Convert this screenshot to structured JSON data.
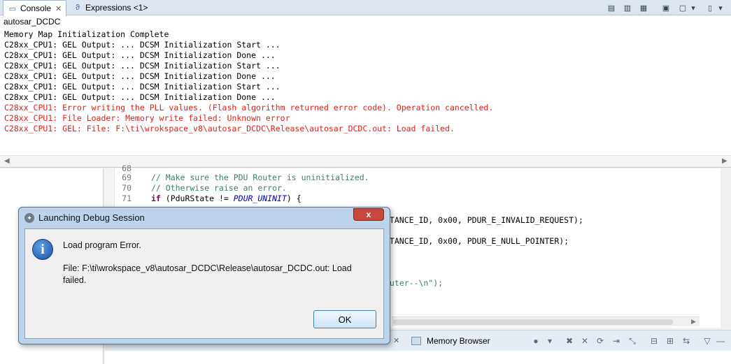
{
  "console": {
    "tabs": [
      {
        "label": "Console",
        "icon": "console-icon"
      },
      {
        "label": "Expressions <1>",
        "icon": "expressions-icon"
      }
    ],
    "name": "autosar_DCDC",
    "lines": [
      {
        "text": "Memory Map Initialization Complete",
        "type": "normal"
      },
      {
        "text": "C28xx_CPU1: GEL Output: ... DCSM Initialization Start ...",
        "type": "normal"
      },
      {
        "text": "C28xx_CPU1: GEL Output: ... DCSM Initialization Done ...",
        "type": "normal"
      },
      {
        "text": "C28xx_CPU1: GEL Output: ... DCSM Initialization Start ...",
        "type": "normal"
      },
      {
        "text": "C28xx_CPU1: GEL Output: ... DCSM Initialization Done ...",
        "type": "normal"
      },
      {
        "text": "C28xx_CPU1: GEL Output: ... DCSM Initialization Start ...",
        "type": "normal"
      },
      {
        "text": "C28xx_CPU1: GEL Output: ... DCSM Initialization Done ...",
        "type": "normal"
      },
      {
        "text": "C28xx_CPU1: Error writing the PLL values. (Flash algorithm returned error code). Operation cancelled.",
        "type": "error"
      },
      {
        "text": "C28xx_CPU1: File Loader: Memory write failed: Unknown error",
        "type": "error"
      },
      {
        "text": "C28xx_CPU1: GEL: File: F:\\ti\\wrokspace_v8\\autosar_DCDC\\Release\\autosar_DCDC.out: Load failed.",
        "type": "error"
      }
    ]
  },
  "editor": {
    "partial_line_number": "68",
    "rows": [
      {
        "num": "69",
        "parts": [
          {
            "t": "// Make sure the PDU Router is uninitialized.",
            "c": "comment"
          }
        ]
      },
      {
        "num": "70",
        "parts": [
          {
            "t": "// Otherwise raise an error.",
            "c": "comment"
          }
        ]
      },
      {
        "num": "71",
        "parts": [
          {
            "t": "if",
            "c": "kw"
          },
          {
            "t": " (PduRState != ",
            "c": "plain"
          },
          {
            "t": "PDUR_UNINIT",
            "c": "ital"
          },
          {
            "t": ") {",
            "c": "plain"
          }
        ]
      }
    ],
    "fragments": [
      "STANCE_ID, 0x00, PDUR_E_INVALID_REQUEST);",
      "STANCE_ID, 0x00, PDUR_E_NULL_POINTER);",
      "outer--\\n\");"
    ]
  },
  "bottom_panel": {
    "tab_label": "Memory Browser"
  },
  "dialog": {
    "title": "Launching Debug Session",
    "close_label": "x",
    "message": "Load program Error.",
    "detail": "File: F:\\ti\\wrokspace_v8\\autosar_DCDC\\Release\\autosar_DCDC.out: Load failed.",
    "ok_label": "OK"
  }
}
